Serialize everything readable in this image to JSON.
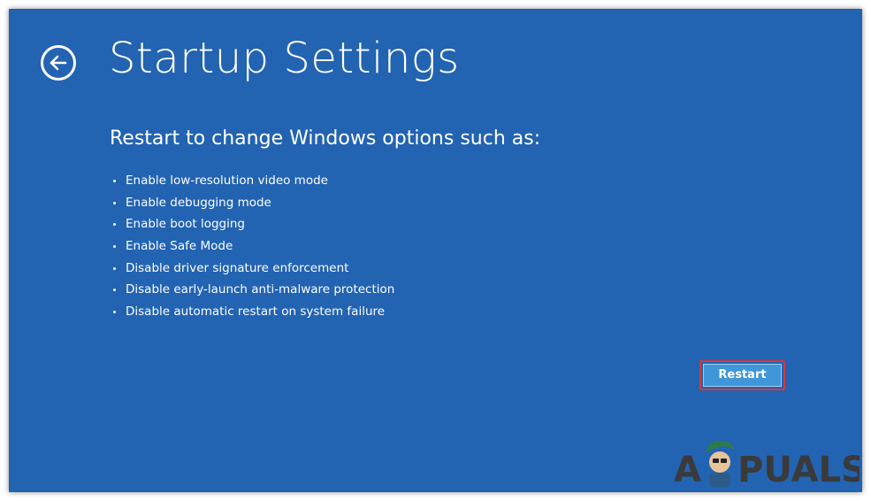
{
  "page": {
    "title": "Startup Settings",
    "subtitle": "Restart to change Windows options such as:"
  },
  "options": [
    "Enable low-resolution video mode",
    "Enable debugging mode",
    "Enable boot logging",
    "Enable Safe Mode",
    "Disable driver signature enforcement",
    "Disable early-launch anti-malware protection",
    "Disable automatic restart on system failure"
  ],
  "actions": {
    "restart_label": "Restart"
  },
  "icons": {
    "back": "back-arrow-icon"
  },
  "watermark": {
    "text": "APPUALS"
  },
  "colors": {
    "background": "#2263b2",
    "button": "#3f97d9",
    "highlight": "#d9373a",
    "text": "#ffffff"
  }
}
